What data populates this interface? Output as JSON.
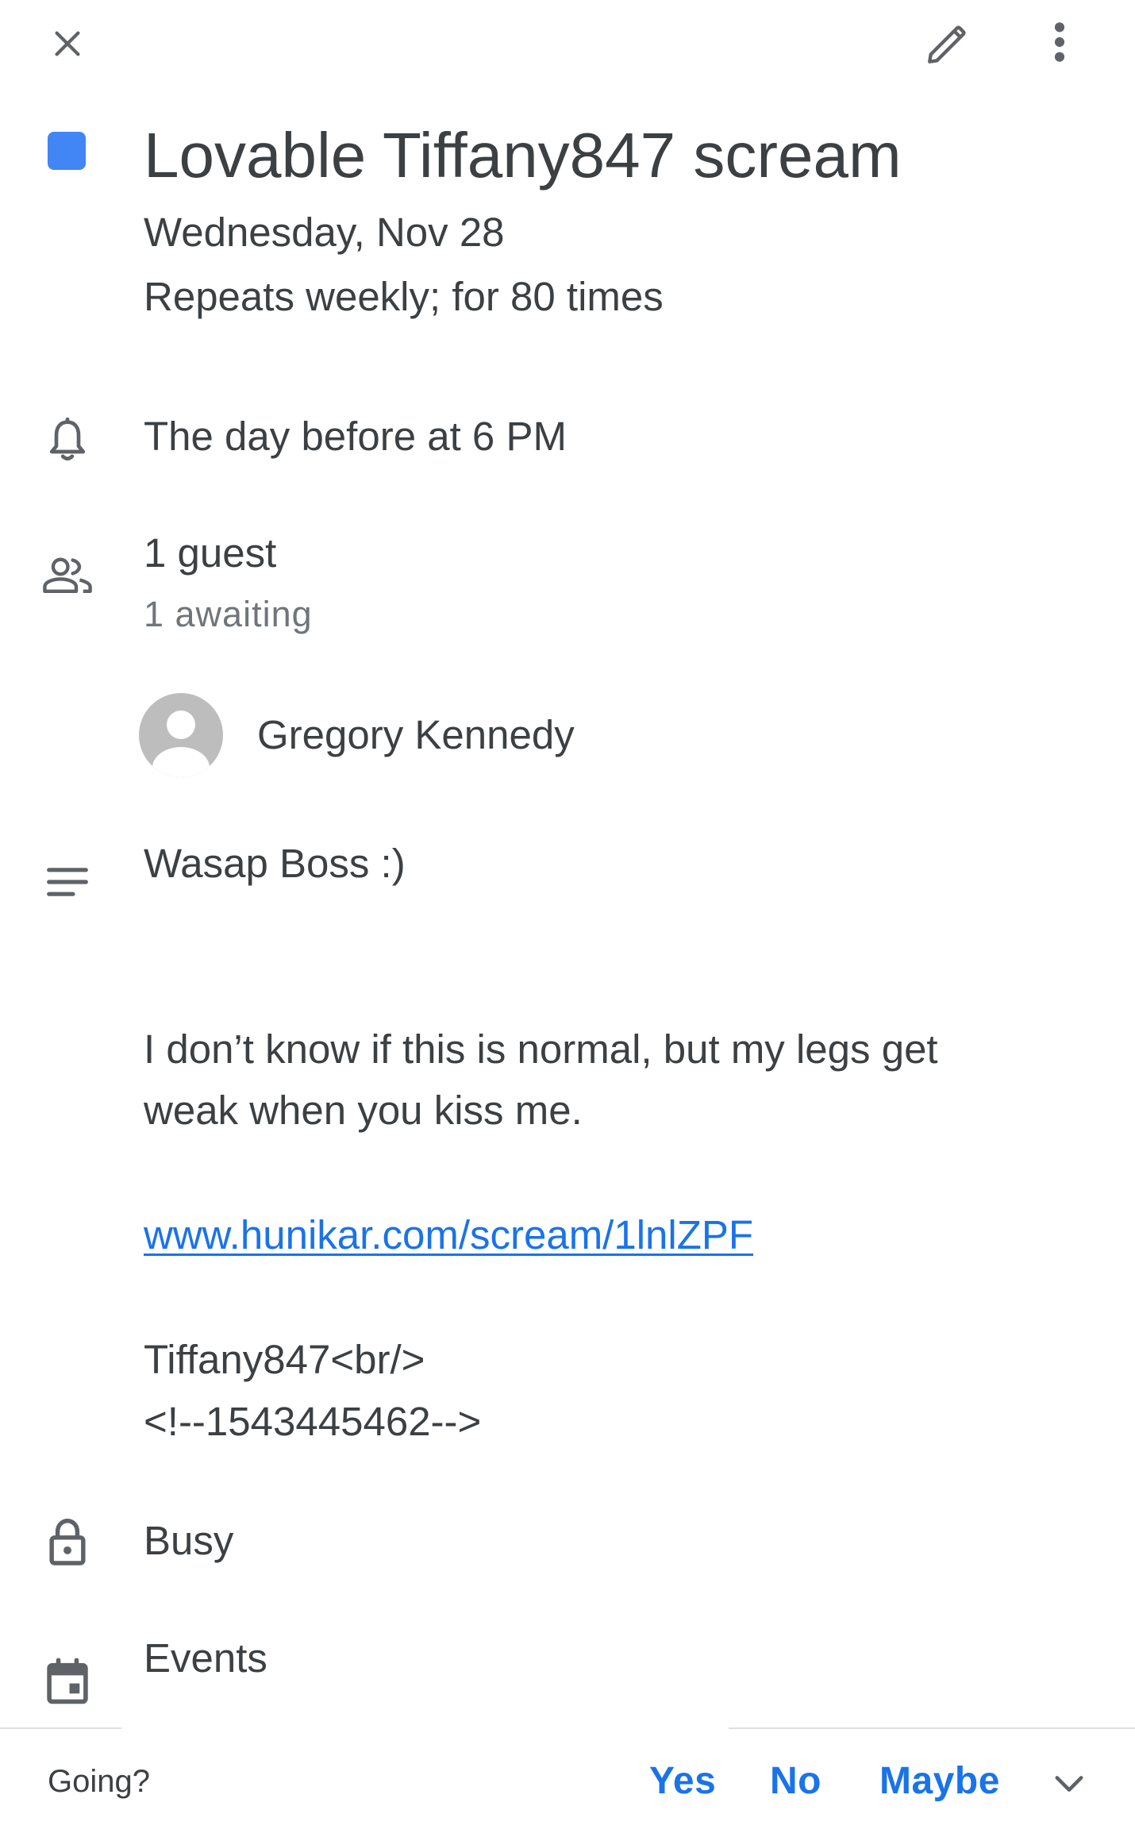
{
  "toolbar": {
    "close_icon": "close-icon",
    "edit_icon": "pencil-icon",
    "more_icon": "more-vert-icon"
  },
  "event": {
    "color": "#4285f4",
    "title": "Lovable Tiffany847 scream",
    "date": "Wednesday, Nov 28",
    "recurrence": "Repeats weekly; for 80 times"
  },
  "reminder": {
    "icon": "bell-icon",
    "text": "The day before at 6 PM"
  },
  "guests": {
    "icon": "people-icon",
    "summary": "1 guest",
    "status": "1 awaiting",
    "list": [
      {
        "name": "Gregory Kennedy",
        "avatar": "default-avatar"
      }
    ]
  },
  "description": {
    "icon": "notes-icon",
    "line1": "Wasap Boss :)",
    "line2": "I don’t know if this is normal, but my legs get",
    "line3": "weak when you kiss me.",
    "link": "www.hunikar.com/scream/1lnlZPF",
    "line4": "Tiffany847<br/>",
    "line5": "<!--1543445462-->"
  },
  "availability": {
    "icon": "lock-icon",
    "text": "Busy"
  },
  "calendar": {
    "icon": "calendar-icon",
    "text": "Events"
  },
  "rsvp": {
    "label": "Going?",
    "yes": "Yes",
    "no": "No",
    "maybe": "Maybe",
    "expand_icon": "chevron-down-icon",
    "accent": "#1a73e8"
  }
}
